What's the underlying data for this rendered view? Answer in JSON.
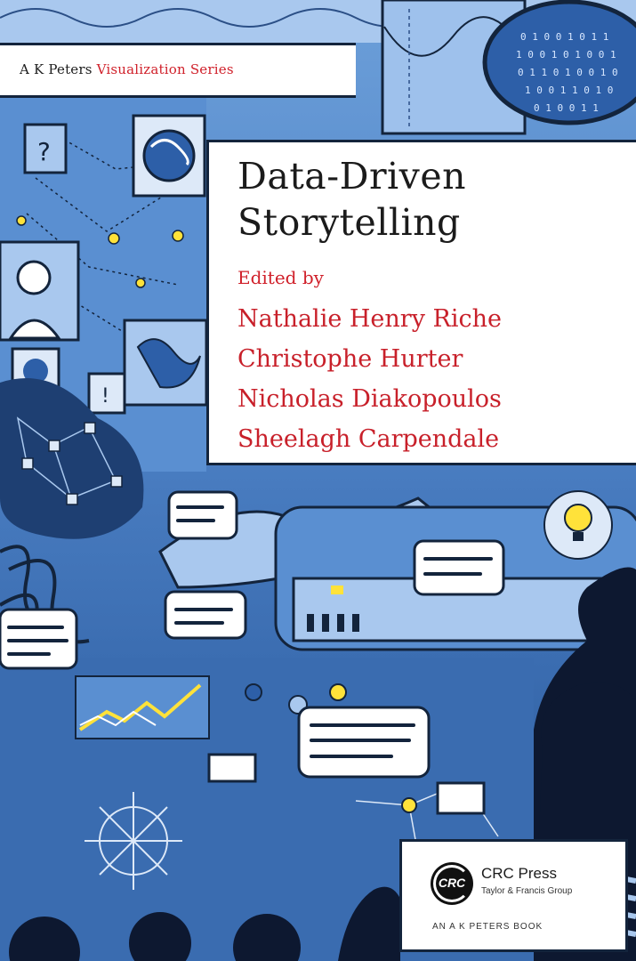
{
  "series": {
    "prefix": "A K Peters ",
    "name": "Visualization Series"
  },
  "book": {
    "title_line1": "Data-Driven",
    "title_line2": "Storytelling",
    "edited_by": "Edited by",
    "editors": [
      "Nathalie Henry Riche",
      "Christophe Hurter",
      "Nicholas Diakopoulos",
      "Sheelagh Carpendale"
    ]
  },
  "publisher": {
    "logo_text": "CRC",
    "name": "CRC Press",
    "group": "Taylor & Francis Group",
    "note": "AN A K PETERS BOOK"
  },
  "colors": {
    "accent_red": "#d0202a",
    "navy_outline": "#13243c",
    "cover_blue": "#4f83c7",
    "highlight_yellow": "#ffe23a"
  }
}
